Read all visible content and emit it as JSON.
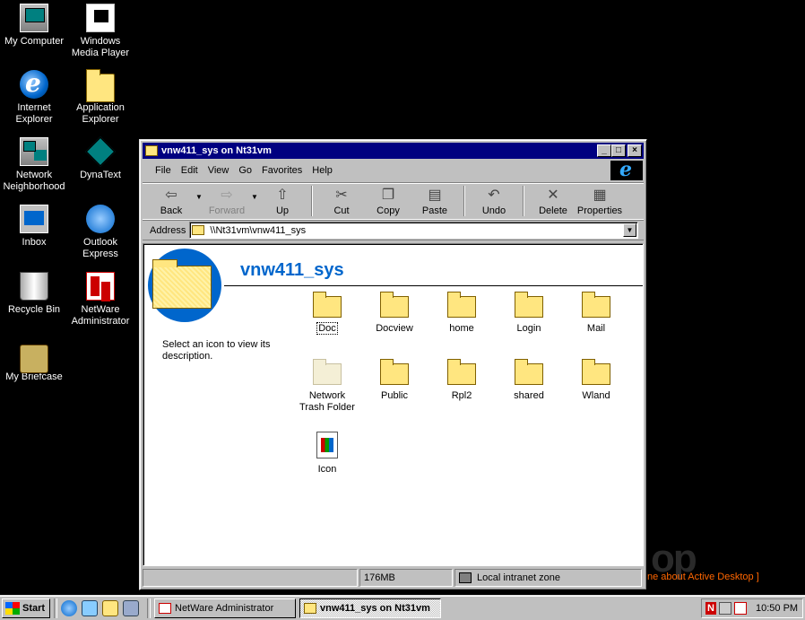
{
  "desktop": {
    "icons": [
      {
        "label": "My Computer"
      },
      {
        "label": "Windows Media Player"
      },
      {
        "label": "Internet Explorer"
      },
      {
        "label": "Application Explorer"
      },
      {
        "label": "Network Neighborhood"
      },
      {
        "label": "DynaText"
      },
      {
        "label": "Inbox"
      },
      {
        "label": "Outlook Express"
      },
      {
        "label": "Recycle Bin"
      },
      {
        "label": "NetWare Administrator"
      },
      {
        "label": "My Briefcase"
      }
    ],
    "active_desktop_link": "ne about Active Desktop ]",
    "watermark": "op"
  },
  "window": {
    "title": "vnw411_sys on Nt31vm",
    "controls": {
      "minimize": "_",
      "maximize": "□",
      "close": "×"
    },
    "menu": [
      "File",
      "Edit",
      "View",
      "Go",
      "Favorites",
      "Help"
    ],
    "toolbar": {
      "back": "Back",
      "forward": "Forward",
      "up": "Up",
      "cut": "Cut",
      "copy": "Copy",
      "paste": "Paste",
      "undo": "Undo",
      "delete": "Delete",
      "properties": "Properties"
    },
    "address": {
      "label": "Address",
      "value": "\\\\Nt31vm\\vnw411_sys"
    },
    "folder_title": "vnw411_sys",
    "description": "Select an icon to view its description.",
    "items": [
      {
        "label": "Doc"
      },
      {
        "label": "Docview"
      },
      {
        "label": "home"
      },
      {
        "label": "Login"
      },
      {
        "label": "Mail"
      },
      {
        "label": "Network Trash Folder"
      },
      {
        "label": "Public"
      },
      {
        "label": "Rpl2"
      },
      {
        "label": "shared"
      },
      {
        "label": "Wland"
      },
      {
        "label": "Icon"
      }
    ],
    "status": {
      "size": "176MB",
      "zone": "Local intranet zone"
    }
  },
  "taskbar": {
    "start": "Start",
    "tasks": [
      {
        "label": "NetWare Administrator"
      },
      {
        "label": "vnw411_sys on Nt31vm"
      }
    ],
    "tray_letter": "N",
    "clock": "10:50 PM"
  },
  "colors": {
    "desktop": "#000000",
    "titlebar": "#000080",
    "folder_title": "#0066cc",
    "link": "#ff6600"
  }
}
